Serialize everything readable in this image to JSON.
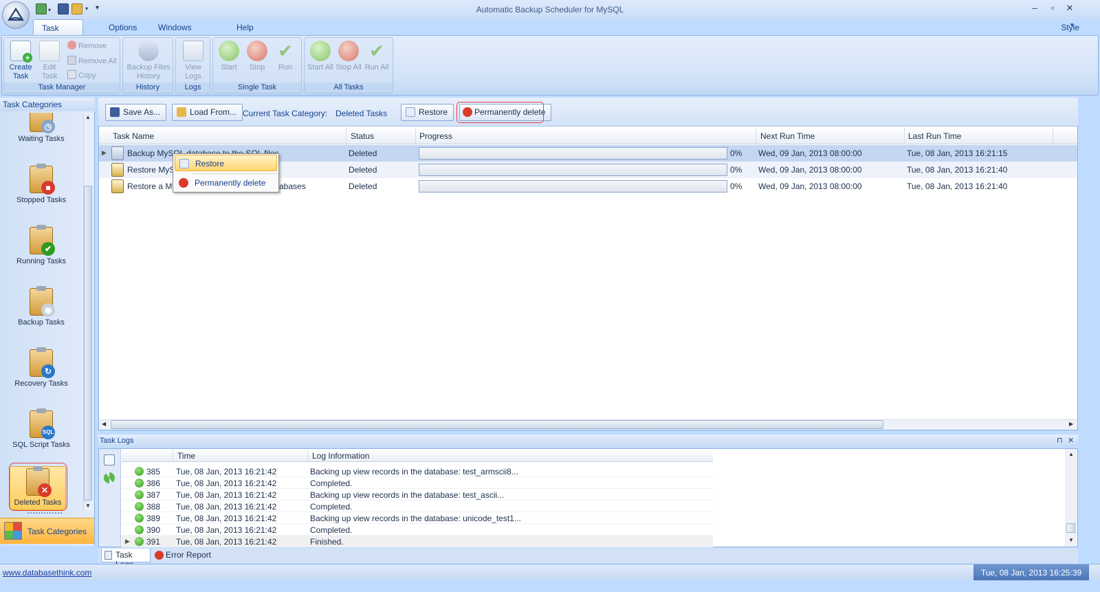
{
  "app": {
    "title": "Automatic Backup Scheduler for MySQL",
    "window_controls": [
      "–",
      "▫",
      "✕"
    ],
    "style_label": "Style"
  },
  "menu": {
    "tabs": [
      "Task Manager",
      "Options",
      "Windows Service",
      "Help"
    ]
  },
  "ribbon": {
    "create_task": "Create Task",
    "edit_task": "Edit Task",
    "remove": "Remove",
    "remove_all": "Remove All",
    "copy": "Copy",
    "group_task_manager": "Task Manager",
    "backup_files_history": "Backup Files History",
    "group_history": "History",
    "view_logs": "View Logs",
    "group_logs": "Logs",
    "start": "Start",
    "stop": "Stop",
    "run": "Run",
    "group_single_task": "Single Task",
    "start_all": "Start All",
    "stop_all": "Stop All",
    "run_all": "Run All",
    "group_all_tasks": "All Tasks"
  },
  "sidebar": {
    "header": "Task Categories",
    "items": [
      {
        "label": "Waiting Tasks"
      },
      {
        "label": "Stopped Tasks"
      },
      {
        "label": "Running Tasks"
      },
      {
        "label": "Backup Tasks"
      },
      {
        "label": "Recovery Tasks"
      },
      {
        "label": "SQL Script Tasks"
      },
      {
        "label": "Deleted Tasks"
      }
    ],
    "footer": "Task Categories"
  },
  "toolbar": {
    "save_as": "Save As...",
    "load_from": "Load From...",
    "current_category_label": "Current Task Category:",
    "current_category_value": "Deleted Tasks",
    "restore": "Restore",
    "permanently_delete": "Permanently delete"
  },
  "grid": {
    "columns": [
      "Task Name",
      "Status",
      "Progress",
      "Next Run Time",
      "Last Run Time"
    ],
    "rows": [
      {
        "name": "Backup MySQL database to the SQL files",
        "status": "Deleted",
        "progress": "0%",
        "next": "Wed, 09 Jan, 2013 08:00:00",
        "last": "Tue, 08 Jan, 2013 16:21:15"
      },
      {
        "name": "Restore MySQL",
        "status": "Deleted",
        "progress": "0%",
        "next": "Wed, 09 Jan, 2013 08:00:00",
        "last": "Tue, 08 Jan, 2013 16:21:40"
      },
      {
        "name": "Restore a MySQL",
        "name_tail": "abases",
        "status": "Deleted",
        "progress": "0%",
        "next": "Wed, 09 Jan, 2013 08:00:00",
        "last": "Tue, 08 Jan, 2013 16:21:40"
      }
    ]
  },
  "context_menu": {
    "restore": "Restore",
    "permanently_delete": "Permanently delete"
  },
  "logs": {
    "title": "Task Logs",
    "columns": [
      "Time",
      "Log Information"
    ],
    "rows": [
      {
        "id": "385",
        "time": "Tue, 08 Jan, 2013 16:21:42",
        "info": "Backing up view records in the database: test_armscii8..."
      },
      {
        "id": "386",
        "time": "Tue, 08 Jan, 2013 16:21:42",
        "info": "Completed."
      },
      {
        "id": "387",
        "time": "Tue, 08 Jan, 2013 16:21:42",
        "info": "Backing up view records in the database: test_ascii..."
      },
      {
        "id": "388",
        "time": "Tue, 08 Jan, 2013 16:21:42",
        "info": "Completed."
      },
      {
        "id": "389",
        "time": "Tue, 08 Jan, 2013 16:21:42",
        "info": "Backing up view records in the database: unicode_test1..."
      },
      {
        "id": "390",
        "time": "Tue, 08 Jan, 2013 16:21:42",
        "info": "Completed."
      },
      {
        "id": "391",
        "time": "Tue, 08 Jan, 2013 16:21:42",
        "info": "Finished."
      }
    ],
    "tabs": [
      "Task Logs",
      "Error Report"
    ],
    "panel_controls": [
      "⊓",
      "✕"
    ]
  },
  "status": {
    "link": "www.databasethink.com",
    "time": "Tue, 08 Jan, 2013 16:25:39"
  },
  "colors": {
    "accent": "#15428b",
    "highlight_red": "#e0404a",
    "selected_row": "#c5d6f0",
    "alt_row": "#eef3fb"
  }
}
